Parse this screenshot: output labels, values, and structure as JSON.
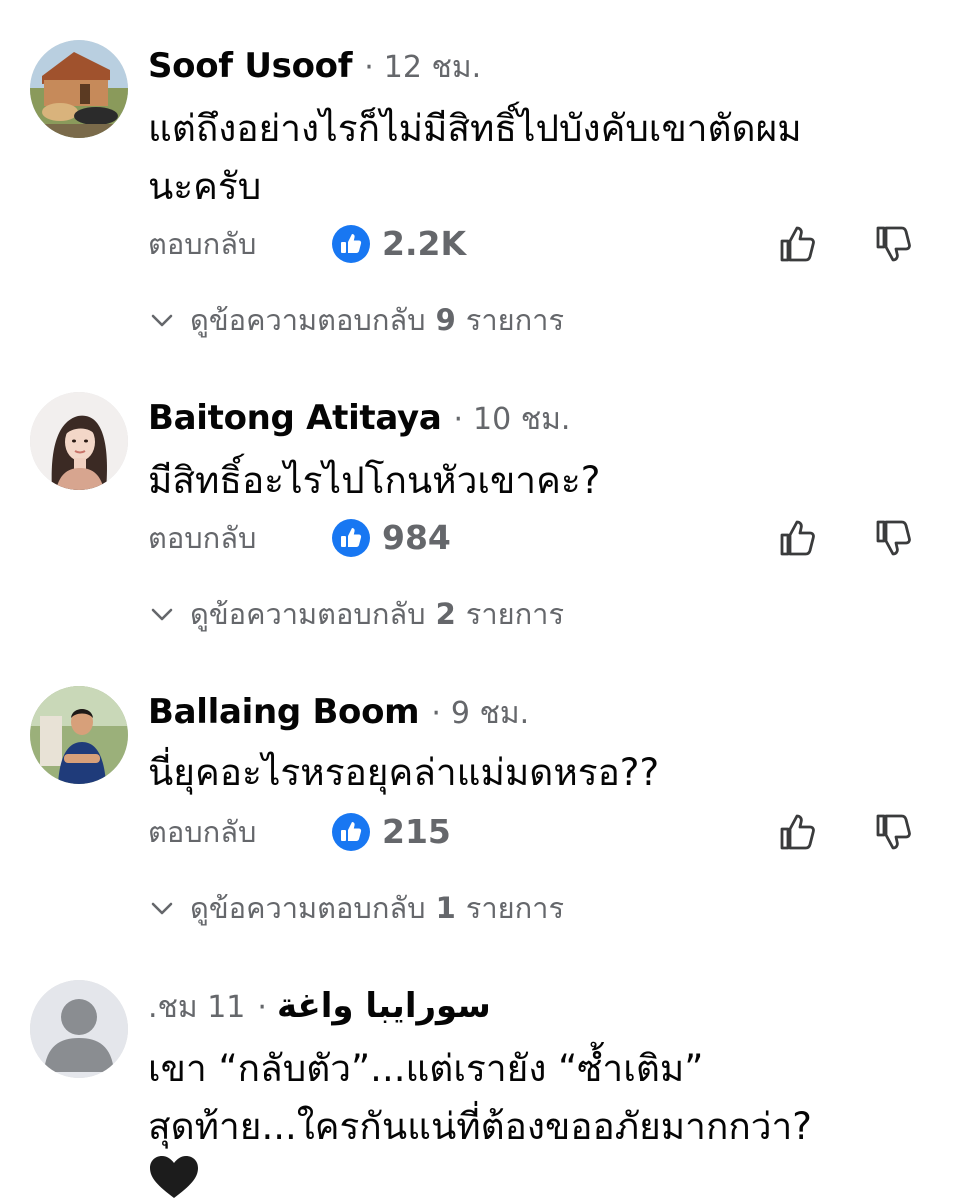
{
  "ui": {
    "reply_label": "ตอบกลับ",
    "view_replies_prefix": "ดูข้อความตอบกลับ",
    "view_replies_suffix": "รายการ",
    "separator": "·"
  },
  "comments": [
    {
      "author": "Soof Usoof",
      "time": "12 ชม.",
      "text_line1": "แต่ถึงอย่างไรก็ไม่มีสิทธิ์ไปบังคับเขาตัดผม",
      "text_line2": "นะครับ",
      "likes": "2.2K",
      "reply_count": "9"
    },
    {
      "author": "Baitong Atitaya",
      "time": "10 ชม.",
      "text_line1": "มีสิทธิ์อะไรไปโกนหัวเขาคะ?",
      "likes": "984",
      "reply_count": "2"
    },
    {
      "author": "Ballaing Boom",
      "time": "9 ชม.",
      "text_line1": "นี่ยุคอะไรหรอยุคล่าแม่มดหรอ??",
      "likes": "215",
      "reply_count": "1"
    },
    {
      "author": "سورايبا واغة",
      "time": ".ชม 11",
      "text_line1": "เขา “กลับตัว”...แต่เรายัง “ซ้ำเติม”",
      "text_line2": "สุดท้าย...ใครกันแน่ที่ต้องขออภัยมากกว่า?",
      "emoji": "black-heart"
    }
  ],
  "colors": {
    "like_blue": "#1877f2",
    "secondary_text": "#65676b",
    "primary_text": "#050505"
  },
  "icons": [
    "like-badge-icon",
    "thumb-up-icon",
    "thumb-down-icon",
    "chevron-down-icon",
    "default-avatar-icon",
    "black-heart-icon"
  ]
}
